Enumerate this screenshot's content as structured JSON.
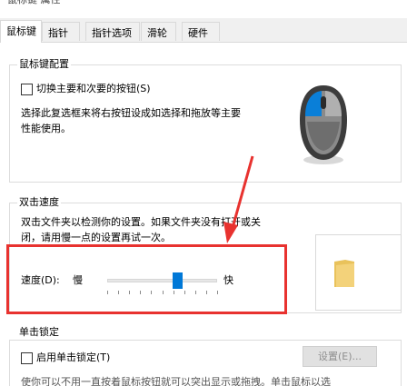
{
  "title": "鼠标键 属性",
  "tabs": [
    {
      "label": "鼠标键"
    },
    {
      "label": "指针"
    },
    {
      "label": "指针选项"
    },
    {
      "label": "滑轮"
    },
    {
      "label": "硬件"
    }
  ],
  "button_config": {
    "group_title": "鼠标键配置",
    "swap_label": "切换主要和次要的按钮(S)",
    "swap_checked": false,
    "description_line1": "选择此复选框来将右按钮设成如选择和拖放等主要",
    "description_line2": "性能使用。"
  },
  "double_click": {
    "group_title": "双击速度",
    "description_line1": "双击文件夹以检测你的设置。如果文件夹没有打开或关",
    "description_line2": "闭，请用慢一点的设置再试一次。",
    "speed_label": "速度(D):",
    "slow_label": "慢",
    "fast_label": "快",
    "speed_fraction": 0.64
  },
  "click_lock": {
    "group_title": "单击锁定",
    "enable_label": "启用单击锁定(T)",
    "enable_checked": false,
    "settings_button": "设置(E)...",
    "description_partial": "使你可以不用一直按着鼠标按钮就可以突出显示或拖拽。单击鼠标以选"
  },
  "colors": {
    "accent": "#0078d7",
    "annotation": "#e8322f",
    "folder": "#f3d27a"
  }
}
